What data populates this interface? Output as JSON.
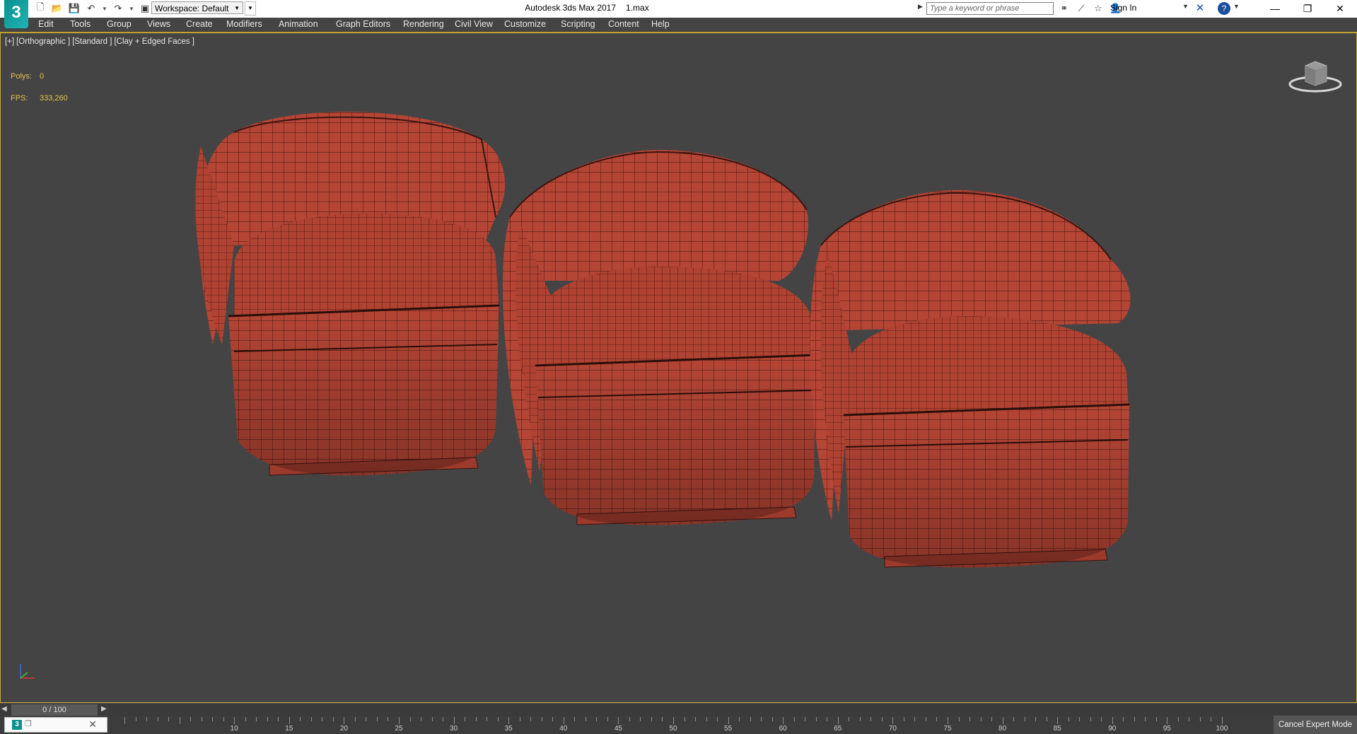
{
  "titlebar": {
    "logo_text": "3",
    "workspace_label": "Workspace: Default",
    "app_title": "Autodesk 3ds Max 2017",
    "file_name": "1.max",
    "search_placeholder": "Type a keyword or phrase",
    "sign_in": "Sign In",
    "help_glyph": "?",
    "x_glyph": "✕"
  },
  "menu": [
    "Edit",
    "Tools",
    "Group",
    "Views",
    "Create",
    "Modifiers",
    "Animation",
    "Graph Editors",
    "Rendering",
    "Civil View",
    "Customize",
    "Scripting",
    "Content",
    "Help"
  ],
  "viewport": {
    "labels": [
      "[+]",
      "[Orthographic ]",
      "[Standard ]",
      "[Clay + Edged Faces ]"
    ],
    "polys_label": "Polys:",
    "polys_value": "0",
    "fps_label": "FPS:",
    "fps_value": "333,260",
    "mesh_color": "#b54535",
    "wire_color": "#3a1410"
  },
  "timeline": {
    "slider_text": "0 / 100",
    "ruler_labels": [
      "10",
      "15",
      "20",
      "25",
      "30",
      "35",
      "40",
      "45",
      "50",
      "55",
      "60",
      "65",
      "70",
      "75",
      "80",
      "85",
      "90",
      "95",
      "100"
    ],
    "cancel_expert_mode": "Cancel Expert Mode"
  },
  "icons": {
    "new": "new-file-icon",
    "open": "open-file-icon",
    "save": "save-icon",
    "undo": "undo-icon",
    "redo": "redo-icon",
    "project": "project-folder-icon",
    "binoculars": "binoculars-icon",
    "comm": "communication-center-icon",
    "favorite": "star-icon",
    "user": "user-icon"
  }
}
